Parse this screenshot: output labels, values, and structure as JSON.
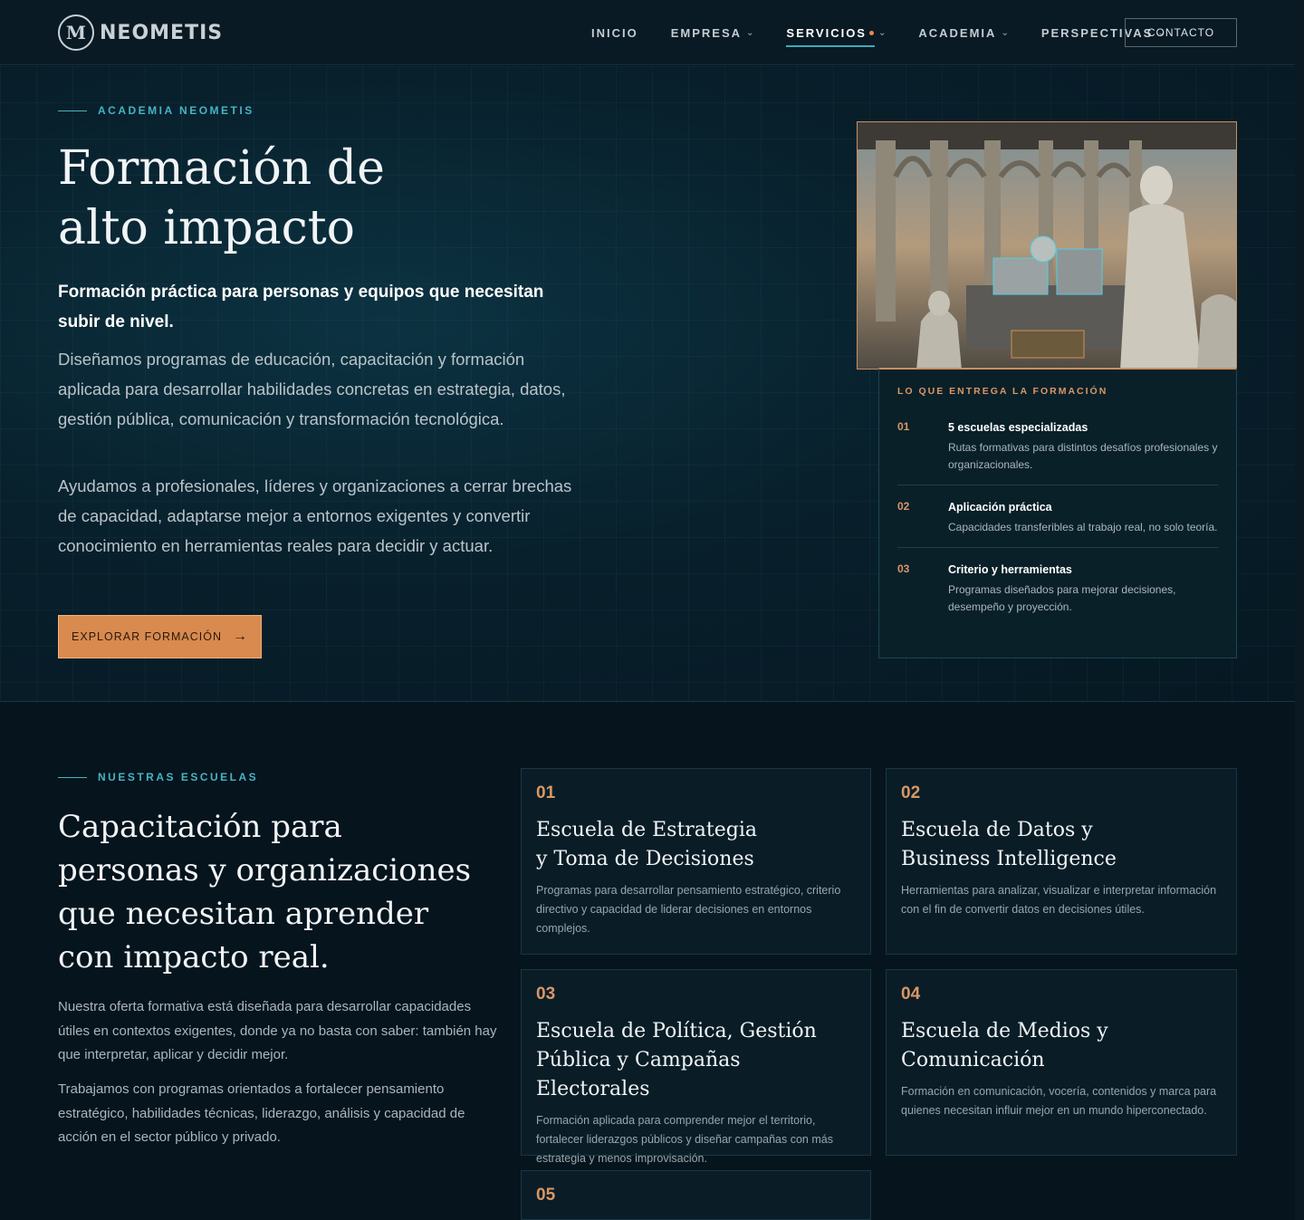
{
  "nav": {
    "logo_text": "NEOMETIS",
    "items": [
      {
        "label": "INICIO"
      },
      {
        "label": "EMPRESA"
      },
      {
        "label": "SERVICIOS"
      },
      {
        "label": "ACADEMIA"
      },
      {
        "label": "PERSPECTIVAS"
      }
    ],
    "contact_label": "CONTACTO",
    "accent": "#3fa9b8"
  },
  "hero": {
    "eyebrow": "ACADEMIA NEOMETIS",
    "title_line1": "Formación de",
    "title_line2": "alto impacto",
    "lead": "Formación práctica para personas y equipos que necesitan subir de nivel.",
    "paragraph1": "Diseñamos programas de educación, capacitación y formación aplicada para desarrollar habilidades concretas en estrategia, datos, gestión pública, comunicación y transformación tecnológica.",
    "paragraph2": "Ayudamos a profesionales, líderes y organizaciones a cerrar brechas de capacidad, adaptarse mejor a entornos exigentes y convertir conocimiento en herramientas reales para decidir y actuar.",
    "cta_label": "EXPLORAR FORMACIÓN",
    "cta_color": "#d98a4e"
  },
  "deliver": {
    "title": "LO QUE ENTREGA LA FORMACIÓN",
    "items": [
      {
        "num": "01",
        "head": "5 escuelas especializadas",
        "desc": "Rutas formativas para distintos desafíos profesionales y organizacionales."
      },
      {
        "num": "02",
        "head": "Aplicación práctica",
        "desc": "Capacidades transferibles al trabajo real, no solo teoría."
      },
      {
        "num": "03",
        "head": "Criterio y herramientas",
        "desc": "Programas diseñados para mejorar decisiones, desempeño y proyección."
      }
    ]
  },
  "schools": {
    "eyebrow": "NUESTRAS ESCUELAS",
    "title_line1": "Capacitación para",
    "title_line2": "personas y organizaciones",
    "title_line3": "que necesitan aprender",
    "title_line4": "con impacto real.",
    "paragraph1": "Nuestra oferta formativa está diseñada para desarrollar capacidades útiles en contextos exigentes, donde ya no basta con saber: también hay que interpretar, aplicar y decidir mejor.",
    "paragraph2": "Trabajamos con programas orientados a fortalecer pensamiento estratégico, habilidades técnicas, liderazgo, análisis y capacidad de acción en el sector público y privado.",
    "cards": [
      {
        "num": "01",
        "name_line1": "Escuela de Estrategia",
        "name_line2": "y Toma de Decisiones",
        "desc": "Programas para desarrollar pensamiento estratégico, criterio directivo y capacidad de liderar decisiones en entornos complejos."
      },
      {
        "num": "02",
        "name_line1": "Escuela de Datos y",
        "name_line2": "Business Intelligence",
        "desc": "Herramientas para analizar, visualizar e interpretar información con el fin de convertir datos en decisiones útiles."
      },
      {
        "num": "03",
        "name_line1": "Escuela de Política, Gestión",
        "name_line2": "Pública y Campañas Electorales",
        "desc": "Formación aplicada para comprender mejor el territorio, fortalecer liderazgos públicos y diseñar campañas con más estrategia y menos improvisación."
      },
      {
        "num": "04",
        "name_line1": "Escuela de Medios y Comunicación",
        "name_line2": "",
        "desc": "Formación en comunicación, vocería, contenidos y marca para quienes necesitan influir mejor en un mundo hiperconectado."
      },
      {
        "num": "05",
        "name_line1": "",
        "name_line2": "",
        "desc": ""
      }
    ]
  }
}
